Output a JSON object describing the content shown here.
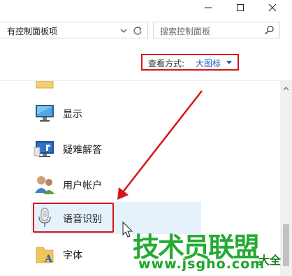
{
  "window": {
    "minimize_glyph": "—",
    "maximize_glyph": "☐",
    "close_glyph": "✕"
  },
  "address_bar": {
    "path": "有控制面板项",
    "search_placeholder": "搜索控制面板"
  },
  "view": {
    "label": "查看方式:",
    "value": "大图标"
  },
  "items": [
    {
      "label": "显示",
      "icon": "display-icon"
    },
    {
      "label": "疑难解答",
      "icon": "troubleshooting-icon"
    },
    {
      "label": "用户帐户",
      "icon": "user-accounts-icon"
    },
    {
      "label": "语音识别",
      "icon": "speech-recognition-icon",
      "selected": true
    },
    {
      "label": "字体",
      "icon": "fonts-icon"
    }
  ],
  "watermark": {
    "main": "技术员联盟",
    "url": "www.jsgho.com",
    "side": "大全"
  },
  "colors": {
    "highlight_border": "#d6151b",
    "link_blue": "#1e62b8",
    "selection_bg": "#e5f1fb",
    "watermark_green": "#1aa62a"
  }
}
